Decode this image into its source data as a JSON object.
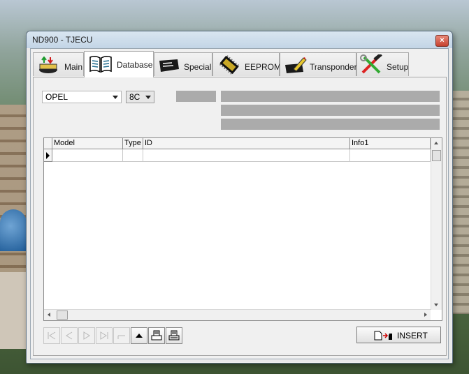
{
  "window": {
    "title": "ND900 - TJECU",
    "close_symbol": "×"
  },
  "tabs": [
    {
      "label": "Main",
      "icon": "main-tab-icon"
    },
    {
      "label": "Database",
      "icon": "book-icon",
      "active": true
    },
    {
      "label": "Special",
      "icon": "special-card-icon"
    },
    {
      "label": "EEPROM",
      "icon": "chip-icon"
    },
    {
      "label": "Transponder",
      "icon": "pen-icon"
    },
    {
      "label": "Setup",
      "icon": "tools-icon"
    }
  ],
  "database": {
    "make_combo": {
      "value": "OPEL"
    },
    "type_combo": {
      "value": "8C"
    }
  },
  "grid": {
    "columns": [
      "Model",
      "Type",
      "ID",
      "Info1"
    ],
    "rows": [
      {
        "model": "",
        "type": "",
        "id": "",
        "info1": ""
      }
    ]
  },
  "navigator": {
    "buttons": [
      "first",
      "prior",
      "next",
      "last",
      "cancel",
      "up",
      "print",
      "print-all"
    ]
  },
  "insert_button": {
    "label": "INSERT"
  }
}
